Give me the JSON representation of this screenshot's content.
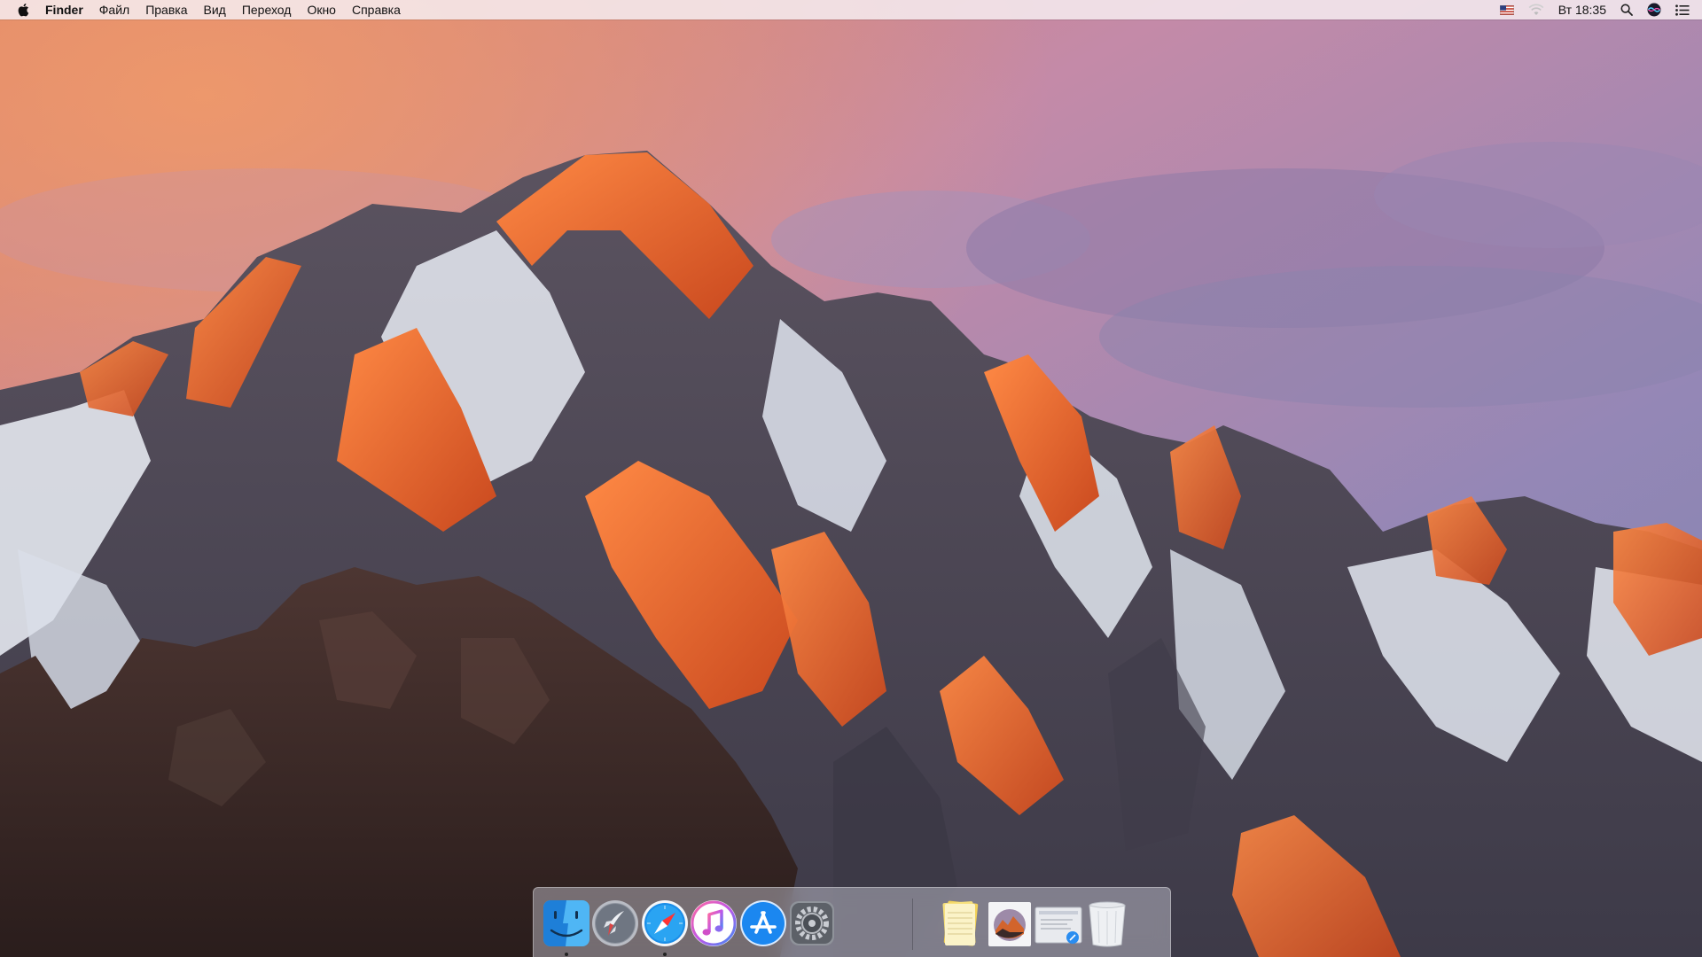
{
  "menubar": {
    "app_name": "Finder",
    "menus": [
      "Файл",
      "Правка",
      "Вид",
      "Переход",
      "Окно",
      "Справка"
    ],
    "clock": "Вт 18:35",
    "status_icons": [
      "flag-us-icon",
      "wifi-icon",
      "search-icon",
      "siri-icon",
      "notification-center-icon"
    ]
  },
  "dock": {
    "apps": [
      {
        "name": "Finder",
        "icon": "finder-icon",
        "running": true
      },
      {
        "name": "Launchpad",
        "icon": "launchpad-icon",
        "running": false
      },
      {
        "name": "Safari",
        "icon": "safari-icon",
        "running": true
      },
      {
        "name": "iTunes",
        "icon": "itunes-icon",
        "running": false
      },
      {
        "name": "App Store",
        "icon": "app-store-icon",
        "running": false
      },
      {
        "name": "System Preferences",
        "icon": "system-preferences-icon",
        "running": false
      }
    ],
    "stacks": [
      {
        "icon": "notes-stack-icon"
      },
      {
        "icon": "photos-stack-icon"
      },
      {
        "icon": "documents-stack-icon"
      },
      {
        "icon": "trash-icon"
      }
    ]
  },
  "colors": {
    "sky_top": "#c9779a",
    "sky_mid": "#9b86b8",
    "alpenglow": "#e0642c",
    "snow": "#e8ecf4",
    "rock_dark": "#3a2a28"
  }
}
